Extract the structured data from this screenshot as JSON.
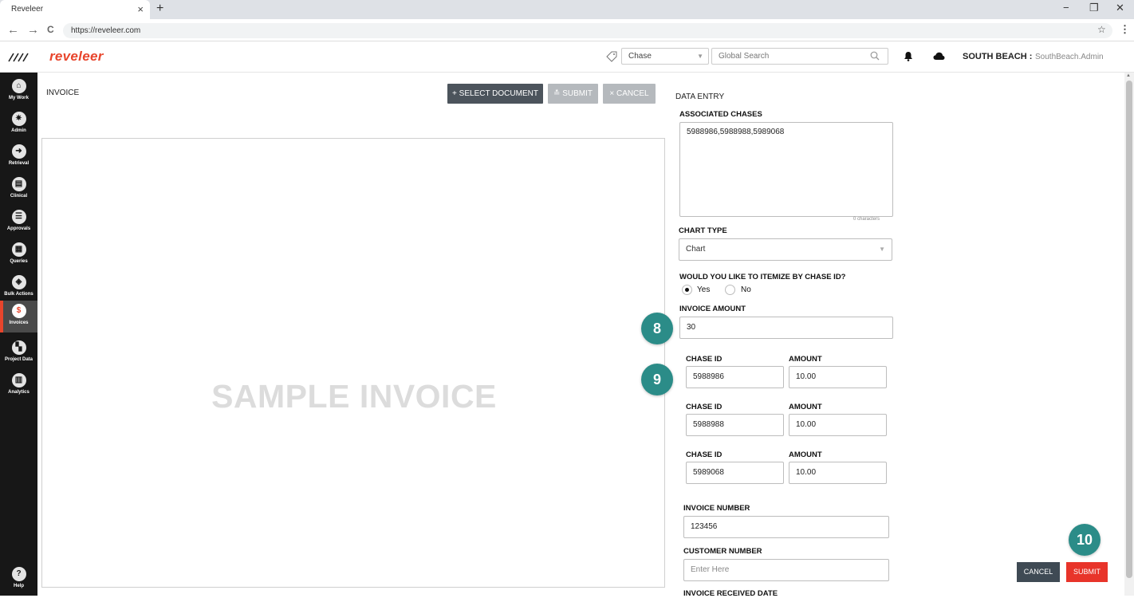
{
  "browser": {
    "tab_title": "Reveleer",
    "tab_close": "×",
    "new_tab": "+",
    "url": "https://reveleer.com",
    "win_min": "−",
    "win_restore": "❐",
    "win_close": "✕",
    "nav_back": "←",
    "nav_forward": "→",
    "nav_reload": "C",
    "star": "☆",
    "menu": "⋮"
  },
  "header": {
    "brand": "reveleer",
    "chase_select": "Chase",
    "search_placeholder": "Global Search",
    "org": "SOUTH BEACH :",
    "user": "SouthBeach.Admin"
  },
  "leftnav": {
    "items": [
      {
        "label": "My Work",
        "glyph": "⌂"
      },
      {
        "label": "Admin",
        "glyph": "✷"
      },
      {
        "label": "Retrieval",
        "glyph": "➜"
      },
      {
        "label": "Clinical",
        "glyph": "▤"
      },
      {
        "label": "Approvals",
        "glyph": "☰"
      },
      {
        "label": "Queries",
        "glyph": "▦"
      },
      {
        "label": "Bulk Actions",
        "glyph": "◈"
      },
      {
        "label": "Invoices",
        "glyph": "$"
      },
      {
        "label": "Project Data",
        "glyph": "▚"
      },
      {
        "label": "Analytics",
        "glyph": "▥"
      }
    ],
    "help_label": "Help",
    "help_glyph": "?"
  },
  "invoice": {
    "title": "INVOICE",
    "select_document": "+ SELECT DOCUMENT",
    "submit": "≛ SUBMIT",
    "cancel": "× CANCEL",
    "watermark": "SAMPLE INVOICE"
  },
  "data_entry": {
    "title": "DATA ENTRY",
    "associated_chases_label": "ASSOCIATED CHASES",
    "associated_chases_value": "5988986,5988988,5989068",
    "char_count": "0 characters",
    "chart_type_label": "CHART TYPE",
    "chart_type_value": "Chart",
    "itemize_label": "WOULD YOU LIKE TO ITEMIZE BY CHASE ID?",
    "itemize_yes": "Yes",
    "itemize_no": "No",
    "invoice_amount_label": "INVOICE AMOUNT",
    "invoice_amount_value": "30",
    "chase_id_label": "CHASE ID",
    "amount_label": "AMOUNT",
    "rows": [
      {
        "chase_id": "5988986",
        "amount": "10.00"
      },
      {
        "chase_id": "5988988",
        "amount": "10.00"
      },
      {
        "chase_id": "5989068",
        "amount": "10.00"
      }
    ],
    "invoice_number_label": "INVOICE NUMBER",
    "invoice_number_value": "123456",
    "customer_number_label": "CUSTOMER NUMBER",
    "customer_number_placeholder": "Enter Here",
    "invoice_received_date_label": "INVOICE RECEIVED DATE",
    "cancel": "CANCEL",
    "submit": "SUBMIT"
  },
  "steps": {
    "s8": "8",
    "s9": "9",
    "s10": "10"
  },
  "colors": {
    "brand": "#e8452c",
    "step_badge": "#2b8c88",
    "submit": "#e8342a",
    "dark_button": "#4c545c"
  }
}
